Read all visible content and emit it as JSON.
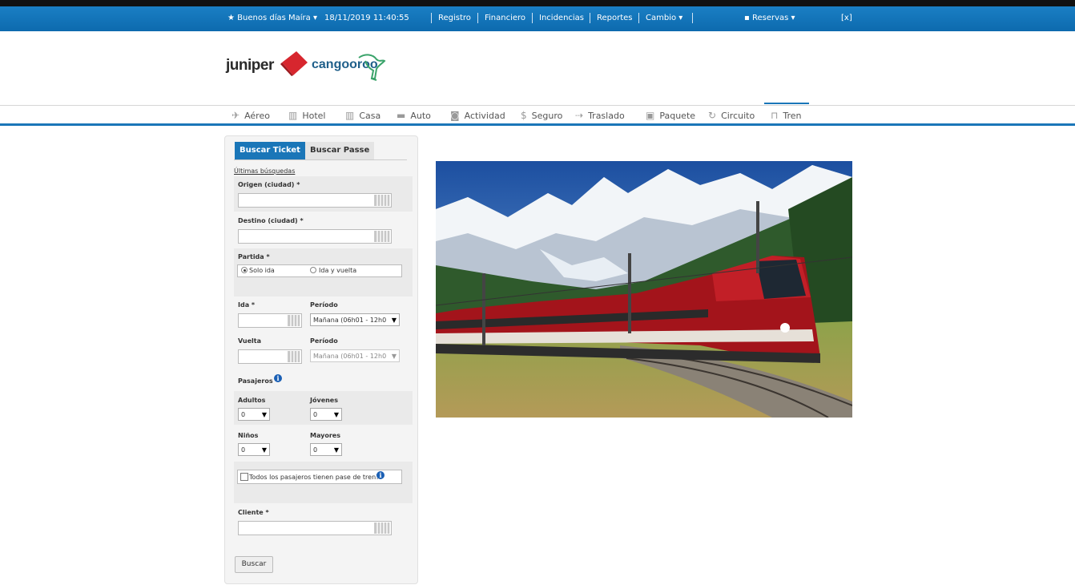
{
  "topbar": {
    "greeting": "Buenos días Maíra",
    "datetime": "18/11/2019 11:40:55",
    "links": [
      "Registro",
      "Financiero",
      "Incidencias",
      "Reportes",
      "Cambio"
    ],
    "reservas": "Reservas",
    "close": "[x]"
  },
  "brand": {
    "logo1": "juniper",
    "logo2": "cangooroo"
  },
  "nav": {
    "items": [
      {
        "label": "Aéreo",
        "icon": "airplane-icon"
      },
      {
        "label": "Hotel",
        "icon": "building-icon"
      },
      {
        "label": "Casa",
        "icon": "house-icon"
      },
      {
        "label": "Auto",
        "icon": "car-icon"
      },
      {
        "label": "Actividad",
        "icon": "camera-icon"
      },
      {
        "label": "Seguro",
        "icon": "dollar-icon"
      },
      {
        "label": "Traslado",
        "icon": "transfer-icon"
      },
      {
        "label": "Paquete",
        "icon": "suitcase-icon"
      },
      {
        "label": "Circuito",
        "icon": "circuit-icon"
      },
      {
        "label": "Tren",
        "icon": "train-icon"
      }
    ],
    "active": "Tren"
  },
  "form": {
    "tabs": [
      "Buscar Ticket",
      "Buscar Passe"
    ],
    "recent": "Últimas búsquedas",
    "origen_label": "Origen (ciudad) *",
    "destino_label": "Destino (ciudad) *",
    "partida_label": "Partida *",
    "radio_solo": "Solo ida",
    "radio_idavuelta": "Ida y vuelta",
    "ida_label": "Ida *",
    "periodo_label": "Período",
    "periodo_value": "Mañana (06h01 - 12h0",
    "vuelta_label": "Vuelta",
    "periodo2_label": "Período",
    "periodo2_value": "Mañana (06h01 - 12h0",
    "pasajeros_label": "Pasajeros",
    "adultos_label": "Adultos",
    "adultos_value": "0",
    "jovenes_label": "Jóvenes",
    "jovenes_value": "0",
    "ninos_label": "Niños",
    "ninos_value": "0",
    "mayores_label": "Mayores",
    "mayores_value": "0",
    "pase_label": "Todos los pasajeros tienen pase de tren?",
    "cliente_label": "Cliente *",
    "buscar": "Buscar"
  },
  "colors": {
    "accent": "#1a76b8",
    "topbar": "#0d6aae",
    "logo_red": "#d7262e"
  }
}
